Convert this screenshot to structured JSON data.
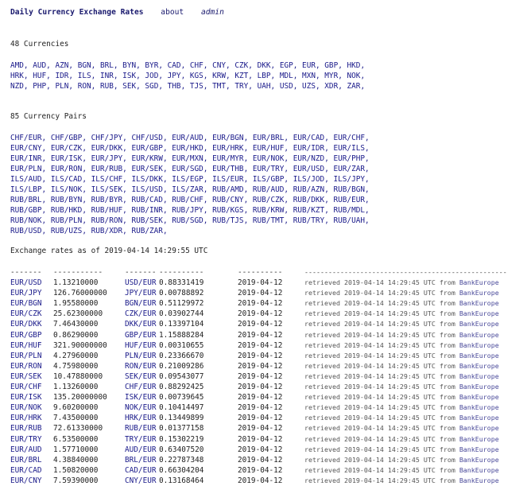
{
  "nav": {
    "title": "Daily Currency Exchange Rates",
    "about": "about",
    "admin": "admin"
  },
  "currencies": {
    "heading": "48 Currencies",
    "items": [
      "AMD",
      "AUD",
      "AZN",
      "BGN",
      "BRL",
      "BYN",
      "BYR",
      "CAD",
      "CHF",
      "CNY",
      "CZK",
      "DKK",
      "EGP",
      "EUR",
      "GBP",
      "HKD",
      "HRK",
      "HUF",
      "IDR",
      "ILS",
      "INR",
      "ISK",
      "JOD",
      "JPY",
      "KGS",
      "KRW",
      "KZT",
      "LBP",
      "MDL",
      "MXN",
      "MYR",
      "NOK",
      "NZD",
      "PHP",
      "PLN",
      "RON",
      "RUB",
      "SEK",
      "SGD",
      "THB",
      "TJS",
      "TMT",
      "TRY",
      "UAH",
      "USD",
      "UZS",
      "XDR",
      "ZAR"
    ]
  },
  "pairs": {
    "heading": "85 Currency Pairs",
    "items": [
      "CHF/EUR",
      "CHF/GBP",
      "CHF/JPY",
      "CHF/USD",
      "EUR/AUD",
      "EUR/BGN",
      "EUR/BRL",
      "EUR/CAD",
      "EUR/CHF",
      "EUR/CNY",
      "EUR/CZK",
      "EUR/DKK",
      "EUR/GBP",
      "EUR/HKD",
      "EUR/HRK",
      "EUR/HUF",
      "EUR/IDR",
      "EUR/ILS",
      "EUR/INR",
      "EUR/ISK",
      "EUR/JPY",
      "EUR/KRW",
      "EUR/MXN",
      "EUR/MYR",
      "EUR/NOK",
      "EUR/NZD",
      "EUR/PHP",
      "EUR/PLN",
      "EUR/RON",
      "EUR/RUB",
      "EUR/SEK",
      "EUR/SGD",
      "EUR/THB",
      "EUR/TRY",
      "EUR/USD",
      "EUR/ZAR",
      "ILS/AUD",
      "ILS/CAD",
      "ILS/CHF",
      "ILS/DKK",
      "ILS/EGP",
      "ILS/EUR",
      "ILS/GBP",
      "ILS/JOD",
      "ILS/JPY",
      "ILS/LBP",
      "ILS/NOK",
      "ILS/SEK",
      "ILS/USD",
      "ILS/ZAR",
      "RUB/AMD",
      "RUB/AUD",
      "RUB/AZN",
      "RUB/BGN",
      "RUB/BRL",
      "RUB/BYN",
      "RUB/BYR",
      "RUB/CAD",
      "RUB/CHF",
      "RUB/CNY",
      "RUB/CZK",
      "RUB/DKK",
      "RUB/EUR",
      "RUB/GBP",
      "RUB/HKD",
      "RUB/HUF",
      "RUB/INR",
      "RUB/JPY",
      "RUB/KGS",
      "RUB/KRW",
      "RUB/KZT",
      "RUB/MDL",
      "RUB/NOK",
      "RUB/PLN",
      "RUB/RON",
      "RUB/SEK",
      "RUB/SGD",
      "RUB/TJS",
      "RUB/TMT",
      "RUB/TRY",
      "RUB/UAH",
      "RUB/USD",
      "RUB/UZS",
      "RUB/XDR",
      "RUB/ZAR"
    ]
  },
  "rates": {
    "as_of": "Exchange rates as of 2019-04-14 14:29:55 UTC",
    "separators": [
      "-------",
      "-----------",
      "-------",
      "----------",
      "----------",
      "---------------------------------------------------"
    ],
    "retrieved_prefix": "retrieved 2019-04-14 14:29:45 UTC from ",
    "source": "BankEurope",
    "rows": [
      {
        "pair": "EUR/USD",
        "rate": "1.13210000",
        "inv_pair": "USD/EUR",
        "inv_rate": "0.88331419",
        "date": "2019-04-12"
      },
      {
        "pair": "EUR/JPY",
        "rate": "126.76000000",
        "inv_pair": "JPY/EUR",
        "inv_rate": "0.00788892",
        "date": "2019-04-12"
      },
      {
        "pair": "EUR/BGN",
        "rate": "1.95580000",
        "inv_pair": "BGN/EUR",
        "inv_rate": "0.51129972",
        "date": "2019-04-12"
      },
      {
        "pair": "EUR/CZK",
        "rate": "25.62300000",
        "inv_pair": "CZK/EUR",
        "inv_rate": "0.03902744",
        "date": "2019-04-12"
      },
      {
        "pair": "EUR/DKK",
        "rate": "7.46430000",
        "inv_pair": "DKK/EUR",
        "inv_rate": "0.13397104",
        "date": "2019-04-12"
      },
      {
        "pair": "EUR/GBP",
        "rate": "0.86290000",
        "inv_pair": "GBP/EUR",
        "inv_rate": "1.15888284",
        "date": "2019-04-12"
      },
      {
        "pair": "EUR/HUF",
        "rate": "321.90000000",
        "inv_pair": "HUF/EUR",
        "inv_rate": "0.00310655",
        "date": "2019-04-12"
      },
      {
        "pair": "EUR/PLN",
        "rate": "4.27960000",
        "inv_pair": "PLN/EUR",
        "inv_rate": "0.23366670",
        "date": "2019-04-12"
      },
      {
        "pair": "EUR/RON",
        "rate": "4.75980000",
        "inv_pair": "RON/EUR",
        "inv_rate": "0.21009286",
        "date": "2019-04-12"
      },
      {
        "pair": "EUR/SEK",
        "rate": "10.47880000",
        "inv_pair": "SEK/EUR",
        "inv_rate": "0.09543077",
        "date": "2019-04-12"
      },
      {
        "pair": "EUR/CHF",
        "rate": "1.13260000",
        "inv_pair": "CHF/EUR",
        "inv_rate": "0.88292425",
        "date": "2019-04-12"
      },
      {
        "pair": "EUR/ISK",
        "rate": "135.20000000",
        "inv_pair": "ISK/EUR",
        "inv_rate": "0.00739645",
        "date": "2019-04-12"
      },
      {
        "pair": "EUR/NOK",
        "rate": "9.60200000",
        "inv_pair": "NOK/EUR",
        "inv_rate": "0.10414497",
        "date": "2019-04-12"
      },
      {
        "pair": "EUR/HRK",
        "rate": "7.43500000",
        "inv_pair": "HRK/EUR",
        "inv_rate": "0.13449899",
        "date": "2019-04-12"
      },
      {
        "pair": "EUR/RUB",
        "rate": "72.61330000",
        "inv_pair": "RUB/EUR",
        "inv_rate": "0.01377158",
        "date": "2019-04-12"
      },
      {
        "pair": "EUR/TRY",
        "rate": "6.53500000",
        "inv_pair": "TRY/EUR",
        "inv_rate": "0.15302219",
        "date": "2019-04-12"
      },
      {
        "pair": "EUR/AUD",
        "rate": "1.57710000",
        "inv_pair": "AUD/EUR",
        "inv_rate": "0.63407520",
        "date": "2019-04-12"
      },
      {
        "pair": "EUR/BRL",
        "rate": "4.38840000",
        "inv_pair": "BRL/EUR",
        "inv_rate": "0.22787348",
        "date": "2019-04-12"
      },
      {
        "pair": "EUR/CAD",
        "rate": "1.50820000",
        "inv_pair": "CAD/EUR",
        "inv_rate": "0.66304204",
        "date": "2019-04-12"
      },
      {
        "pair": "EUR/CNY",
        "rate": "7.59390000",
        "inv_pair": "CNY/EUR",
        "inv_rate": "0.13168464",
        "date": "2019-04-12"
      }
    ]
  }
}
